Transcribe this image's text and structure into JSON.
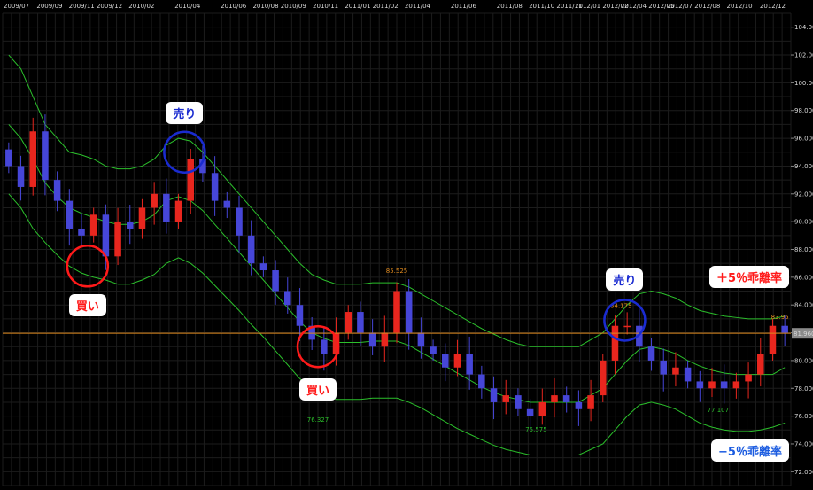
{
  "chart_data": {
    "type": "candlestick",
    "x_tick_labels": [
      "2009/07",
      "2009/09",
      "2009/11 2009/12",
      "2010/02",
      "2010/04",
      "2010/06",
      "2010/08 2010/09",
      "2010/11",
      "2011/01 2011/02",
      "2011/04",
      "2011/06",
      "2011/08",
      "2011/10 2011/11",
      "2012/01 2012/02",
      "2012/04 2012/05",
      "2012/07 2012/08",
      "2012/10",
      "2012/12"
    ],
    "y_ticks": [
      72,
      74,
      76,
      78,
      80,
      82,
      84,
      86,
      88,
      90,
      92,
      94,
      96,
      98,
      100,
      102,
      104
    ],
    "y_tick_labels": [
      "72.000",
      "74.000",
      "76.000",
      "78.000",
      "80.000",
      "82.000",
      "84.000",
      "86.000",
      "88.000",
      "90.000",
      "92.000",
      "94.000",
      "96.000",
      "98.000",
      "100.000",
      "102.000",
      "104.000"
    ],
    "ylim": [
      71,
      105
    ],
    "current_price": 81.96,
    "current_price_label": "81.960",
    "price_path": [
      94.0,
      92.5,
      96.5,
      93.0,
      91.5,
      89.5,
      89.0,
      90.5,
      87.5,
      90.0,
      89.5,
      91.0,
      92.0,
      90.0,
      91.5,
      94.5,
      93.5,
      91.5,
      91.0,
      89.0,
      87.0,
      86.5,
      85.0,
      84.0,
      82.5,
      81.5,
      80.5,
      82.0,
      83.5,
      82.0,
      81.0,
      82.0,
      85.0,
      82.0,
      81.0,
      80.5,
      79.5,
      80.5,
      79.0,
      78.0,
      77.0,
      77.5,
      76.5,
      76.0,
      77.0,
      77.5,
      77.0,
      76.5,
      77.5,
      80.0,
      82.5,
      82.5,
      81.0,
      80.0,
      79.0,
      79.5,
      78.5,
      78.0,
      78.5,
      78.0,
      78.5,
      79.0,
      80.5,
      82.5,
      82.0
    ],
    "series": [
      {
        "name": "",
        "color": "#2bbf2b",
        "values": [
          102.0,
          101.0,
          99.0,
          97.0,
          96.0,
          95.0,
          94.8,
          94.5,
          94.0,
          93.8,
          93.8,
          94.0,
          94.5,
          95.5,
          96.0,
          95.8,
          95.0,
          94.0,
          93.0,
          92.0,
          91.0,
          90.0,
          89.0,
          88.0,
          87.0,
          86.2,
          85.8,
          85.5,
          85.5,
          85.5,
          85.6,
          85.6,
          85.6,
          85.3,
          84.8,
          84.3,
          83.8,
          83.3,
          82.8,
          82.3,
          81.9,
          81.5,
          81.2,
          81.0,
          81.0,
          81.0,
          81.0,
          81.0,
          81.5,
          82.0,
          83.0,
          84.0,
          84.8,
          85.0,
          84.8,
          84.5,
          84.0,
          83.6,
          83.4,
          83.2,
          83.1,
          83.0,
          83.0,
          83.0,
          83.2
        ]
      },
      {
        "name": "",
        "color": "#2bbf2b",
        "values": [
          97.0,
          96.0,
          94.5,
          92.8,
          91.8,
          91.0,
          90.6,
          90.3,
          90.0,
          89.8,
          89.8,
          90.0,
          90.5,
          91.5,
          91.8,
          91.5,
          90.8,
          89.8,
          88.8,
          87.8,
          86.8,
          85.8,
          84.8,
          83.8,
          82.8,
          82.0,
          81.6,
          81.3,
          81.3,
          81.3,
          81.4,
          81.4,
          81.4,
          81.1,
          80.6,
          80.1,
          79.6,
          79.1,
          78.6,
          78.1,
          77.7,
          77.4,
          77.2,
          77.0,
          77.0,
          77.0,
          77.0,
          77.0,
          77.5,
          78.0,
          79.0,
          80.0,
          80.8,
          81.0,
          80.8,
          80.5,
          80.0,
          79.6,
          79.3,
          79.1,
          79.0,
          79.0,
          79.0,
          79.0,
          79.5
        ]
      },
      {
        "name": "",
        "color": "#2bbf2b",
        "values": [
          92.0,
          91.0,
          89.5,
          88.5,
          87.6,
          86.8,
          86.3,
          86.0,
          85.8,
          85.5,
          85.5,
          85.8,
          86.2,
          87.0,
          87.4,
          87.0,
          86.3,
          85.4,
          84.5,
          83.6,
          82.6,
          81.7,
          80.7,
          79.7,
          78.7,
          78.0,
          77.6,
          77.2,
          77.2,
          77.2,
          77.3,
          77.3,
          77.3,
          77.0,
          76.6,
          76.1,
          75.6,
          75.1,
          74.7,
          74.3,
          73.9,
          73.6,
          73.4,
          73.2,
          73.2,
          73.2,
          73.2,
          73.2,
          73.6,
          74.0,
          75.0,
          76.0,
          76.8,
          77.0,
          76.8,
          76.5,
          76.0,
          75.5,
          75.2,
          75.0,
          74.9,
          74.9,
          75.0,
          75.2,
          75.5
        ]
      }
    ],
    "price_labels": [
      {
        "text": "76.327",
        "x_index": 25.5,
        "price": 75.6,
        "color": "#2bbf2b"
      },
      {
        "text": "85.525",
        "x_index": 32,
        "price": 86.3,
        "color": "#e08a1e"
      },
      {
        "text": "75.575",
        "x_index": 43.5,
        "price": 74.9,
        "color": "#2bbf2b"
      },
      {
        "text": "84.175",
        "x_index": 50.5,
        "price": 83.8,
        "color": "#e08a1e"
      },
      {
        "text": "77.107",
        "x_index": 58.5,
        "price": 76.3,
        "color": "#2bbf2b"
      },
      {
        "text": "83.95",
        "x_index": 63.6,
        "price": 83.0,
        "color": "#e08a1e"
      }
    ],
    "annotations": [
      {
        "kind": "sell",
        "text": "売り",
        "circle_color": "#1a2bd0",
        "text_color": "#1a2bd0",
        "x_index": 14.5,
        "price": 95.0,
        "label_price": 97.8
      },
      {
        "kind": "buy",
        "text": "買い",
        "circle_color": "#ff1a1a",
        "text_color": "#ff1a1a",
        "x_index": 6.5,
        "price": 86.8,
        "label_price": 84.0
      },
      {
        "kind": "buy",
        "text": "買い",
        "circle_color": "#ff1a1a",
        "text_color": "#ff1a1a",
        "x_index": 25.5,
        "price": 81.0,
        "label_price": 77.9
      },
      {
        "kind": "sell",
        "text": "売り",
        "circle_color": "#1a2bd0",
        "text_color": "#1a2bd0",
        "x_index": 50.8,
        "price": 82.9,
        "label_price": 85.8
      },
      {
        "kind": "band",
        "text": "＋5％乖離率",
        "circle_color": "",
        "text_color": "#ff1a1a",
        "x_index": 58.5,
        "price": 86.0,
        "label_price": 86.0
      },
      {
        "kind": "band",
        "text": "−5％乖離率",
        "circle_color": "",
        "text_color": "#1a5be0",
        "x_index": 58.5,
        "price": 73.5,
        "label_price": 73.5
      }
    ]
  },
  "colors": {
    "background": "#000000",
    "grid": "#1c1c1c",
    "up_candle": "#e8261e",
    "down_candle": "#4646d8",
    "band": "#2bbf2b",
    "current_price_line": "#e08a1e",
    "axis_text": "#d8d8d8"
  }
}
